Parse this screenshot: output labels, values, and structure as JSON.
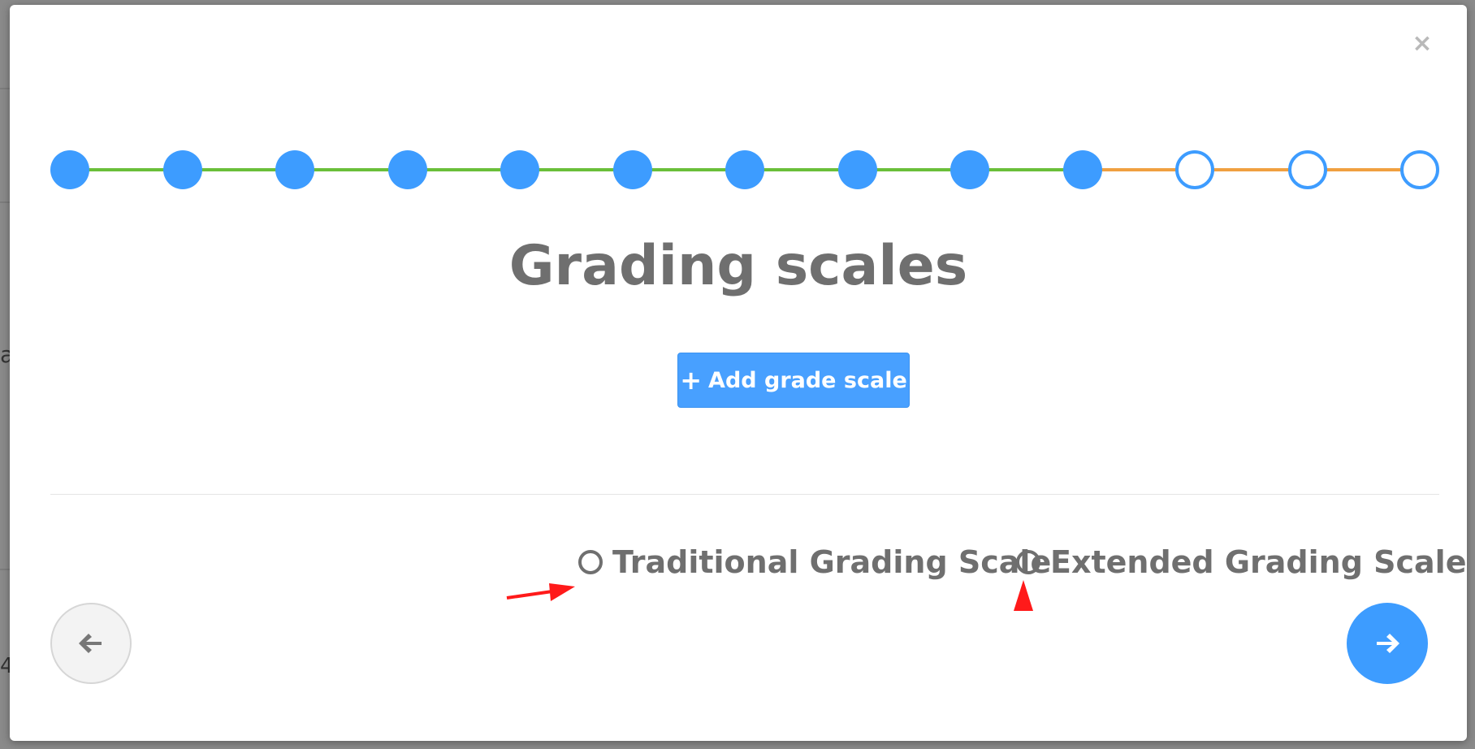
{
  "modal": {
    "title": "Grading scales",
    "close_glyph": "×",
    "add_button": {
      "icon": "plus-icon",
      "plus_glyph": "+",
      "label": "Add grade scale"
    },
    "options": [
      {
        "label": "Traditional Grading Scale",
        "checked": false
      },
      {
        "label": "Extended Grading Scale",
        "checked": false
      }
    ],
    "prev_icon": "arrow-left-icon",
    "next_icon": "arrow-right-icon"
  },
  "stepper": {
    "total_steps": 13,
    "completed_steps": 10,
    "done_color": "#3d9cff",
    "done_line_color": "#6abf3a",
    "pending_line_color": "#f0a040"
  },
  "colors": {
    "accent": "#3d9cff",
    "button": "#48a0ff",
    "text": "#6f6f6f",
    "annotation_arrow": "#ff1a1a"
  },
  "backdrop": {
    "fragments": [
      "a",
      "4"
    ]
  }
}
